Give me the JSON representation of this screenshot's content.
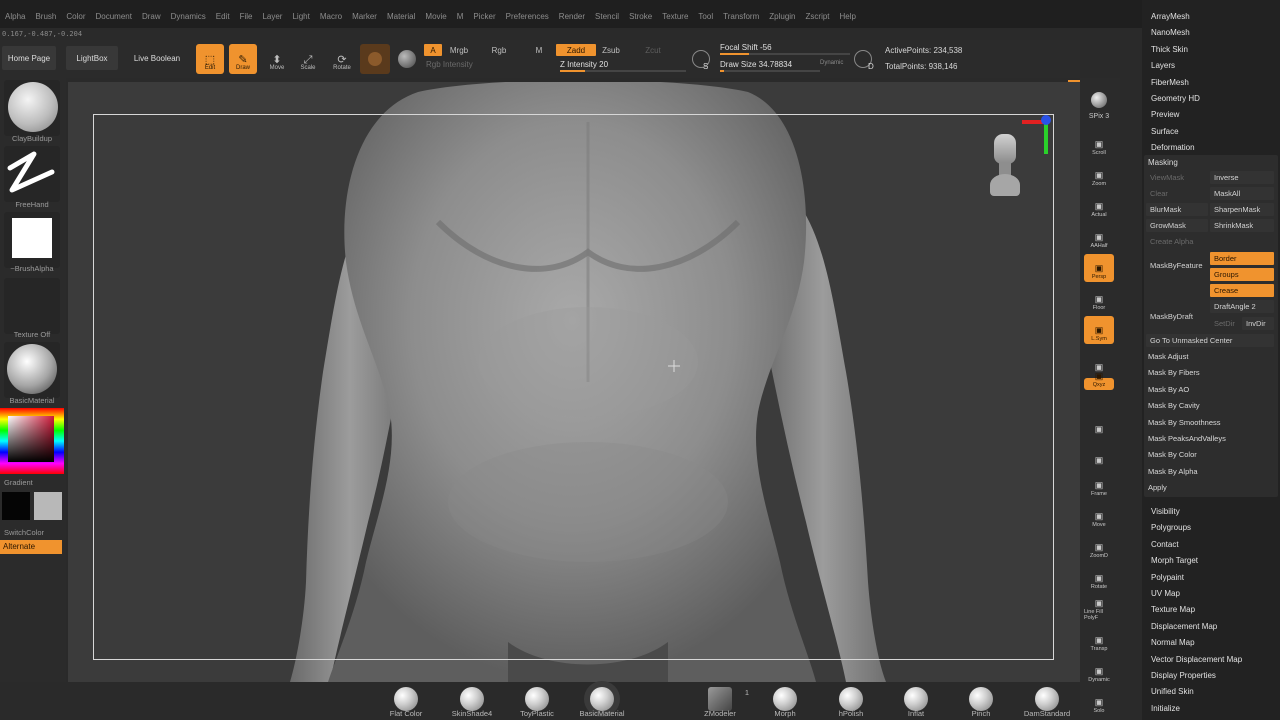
{
  "menu": [
    "Alpha",
    "Brush",
    "Color",
    "Document",
    "Draw",
    "Dynamics",
    "Edit",
    "File",
    "Layer",
    "Light",
    "Macro",
    "Marker",
    "Material",
    "Movie",
    "M",
    "Picker",
    "Preferences",
    "Render",
    "Stencil",
    "Stroke",
    "Texture",
    "Tool",
    "Transform",
    "Zplugin",
    "Zscript",
    "Help"
  ],
  "coords": "0.167,-0.487,-0.204",
  "toolbar": {
    "home": "Home Page",
    "lightbox": "LightBox",
    "live_boolean": "Live Boolean",
    "edit": "Edit",
    "draw": "Draw",
    "move": "Move",
    "scale": "Scale",
    "rotate": "Rotate",
    "a": "A",
    "mrgb": "Mrgb",
    "rgb": "Rgb",
    "m": "M",
    "rgb_intensity": "Rgb Intensity",
    "zadd": "Zadd",
    "zsub": "Zsub",
    "zcut": "Zcut",
    "z_intensity": "Z Intensity 20",
    "z_intensity_value": 0.2,
    "focal_shift": "Focal Shift -56",
    "focal_shift_value": 0.22,
    "draw_size": "Draw Size 34.78834",
    "draw_size_value": 0.04,
    "dynamic": "Dynamic",
    "s": "S",
    "d": "D",
    "active_points": "ActivePoints: 234,538",
    "total_points": "TotalPoints: 938,146"
  },
  "left": {
    "brush_label": "ClayBuildup",
    "stroke_label": "FreeHand",
    "alpha_label": "~BrushAlpha",
    "texture_label": "Texture Off",
    "material_label": "BasicMaterial",
    "gradient_label": "Gradient",
    "switch_label": "SwitchColor",
    "alternate_label": "Alternate"
  },
  "right": {
    "spix": "SPix 3",
    "buttons": [
      "Scroll",
      "Zoom",
      "Actual",
      "AAHalf",
      "Persp",
      "Floor",
      "L.Sym",
      "",
      "Qxyz",
      "",
      "",
      "Frame",
      "Move",
      "ZoomD",
      "Rotate",
      "Line Fill PolyF",
      "Transp",
      "Dynamic",
      "Solo",
      ""
    ]
  },
  "panel": {
    "top_items": [
      "ArrayMesh",
      "NanoMesh",
      "Thick Skin",
      "Layers",
      "FiberMesh",
      "Geometry HD",
      "Preview",
      "Surface",
      "Deformation"
    ],
    "masking_title": "Masking",
    "view_mask": "ViewMask",
    "inverse": "Inverse",
    "clear": "Clear",
    "mask_all": "MaskAll",
    "blur_mask": "BlurMask",
    "sharpen_mask": "SharpenMask",
    "grow_mask": "GrowMask",
    "shrink_mask": "ShrinkMask",
    "create_alpha": "Create Alpha",
    "mask_by_feature": "MaskByFeature",
    "border": "Border",
    "groups": "Groups",
    "crease": "Crease",
    "mask_by_draft": "MaskByDraft",
    "draft_angle": "DraftAngle 2",
    "set_dir": "SetDir",
    "inv_dir": "InvDir",
    "go_unmasked": "Go To Unmasked Center",
    "mask_items": [
      "Mask Adjust",
      "Mask By Fibers",
      "Mask By AO",
      "Mask By Cavity",
      "Mask By Smoothness",
      "Mask PeaksAndValleys",
      "Mask By Color",
      "Mask By Alpha",
      "Apply"
    ],
    "bottom_items": [
      "Visibility",
      "Polygroups",
      "Contact",
      "Morph Target",
      "Polypaint",
      "UV Map",
      "Texture Map",
      "Displacement Map",
      "Normal Map",
      "Vector Displacement Map",
      "Display Properties",
      "Unified Skin",
      "Initialize"
    ]
  },
  "bottom": {
    "materials": [
      "Flat Color",
      "SkinShade4",
      "ToyPlastic",
      "BasicMaterial",
      "ZModeler",
      "Morph",
      "hPolish",
      "Inflat",
      "Pinch",
      "DamStandard"
    ],
    "zmodeler_count": "1"
  }
}
